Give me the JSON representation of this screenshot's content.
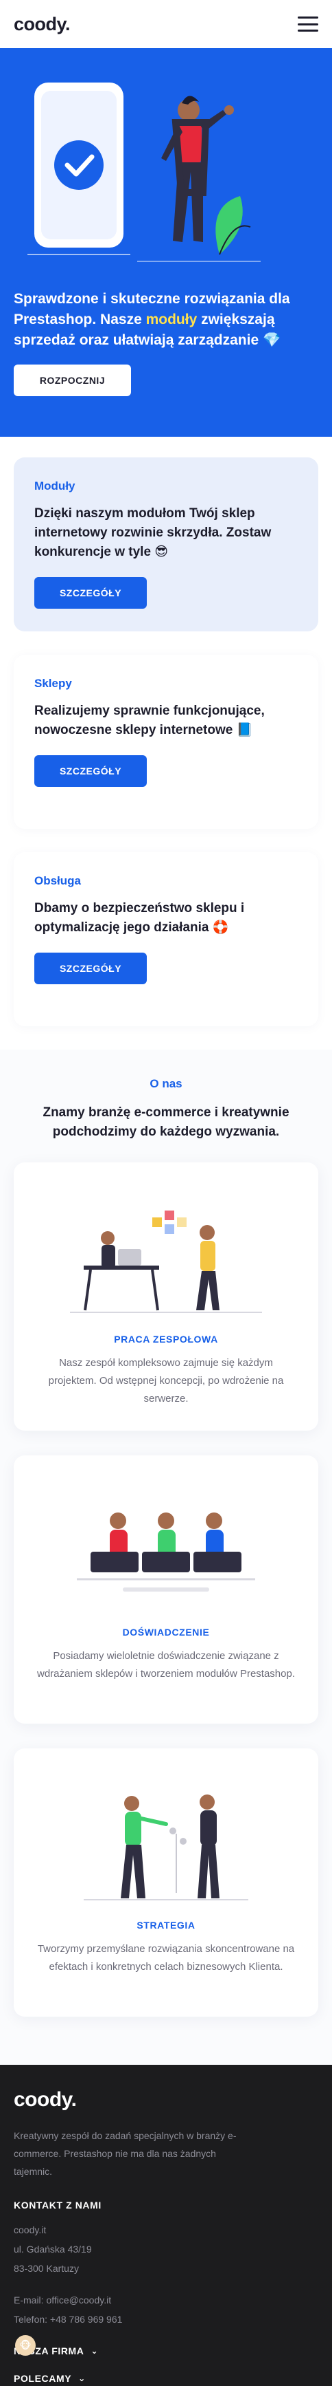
{
  "header": {
    "logo": "coody.",
    "menu_icon": "hamburger-menu-icon"
  },
  "hero": {
    "text_a": "Sprawdzone i skuteczne rozwiązania dla Prestashop. Nasze ",
    "text_highlight": "moduły",
    "text_b": " zwiększają sprzedaż oraz ułatwiają zarządzanie",
    "emoji": "💎",
    "button": "ROZPOCZNIJ",
    "colors": {
      "background": "#1860e8",
      "highlight": "#ffe14d"
    }
  },
  "services": [
    {
      "title": "Moduły",
      "text": "Dzięki naszym modułom Twój sklep internetowy rozwinie skrzydła. Zostaw konkurencje w tyle 😎",
      "button": "SZCZEGÓŁY"
    },
    {
      "title": "Sklepy",
      "text": "Realizujemy sprawnie funkcjonujące, nowoczesne sklepy internetowe 📘",
      "button": "SZCZEGÓŁY"
    },
    {
      "title": "Obsługa",
      "text": "Dbamy o bezpieczeństwo sklepu i optymalizację jego działania 🛟",
      "button": "SZCZEGÓŁY"
    }
  ],
  "about": {
    "title": "O nas",
    "heading": "Znamy branżę e-commerce i kreatywnie podchodzimy do każdego wyzwania.",
    "features": [
      {
        "title": "PRACA ZESPOŁOWA",
        "text": "Nasz zespół kompleksowo zajmuje się każdym projektem. Od wstępnej koncepcji, po wdrożenie na serwerze."
      },
      {
        "title": "DOŚWIADCZENIE",
        "text": "Posiadamy wieloletnie doświadczenie związane z wdrażaniem sklepów i tworzeniem modułów Prestashop."
      },
      {
        "title": "STRATEGIA",
        "text": "Tworzymy przemyślane rozwiązania skoncentrowane na efektach i konkretnych celach biznesowych Klienta."
      }
    ]
  },
  "footer": {
    "logo": "coody.",
    "description": "Kreatywny zespół do zadań specjalnych w branży e-commerce. Prestashop nie ma dla nas żadnych tajemnic.",
    "contact_heading": "KONTAKT Z NAMI",
    "address": [
      "coody.it",
      "ul. Gdańska 43/19",
      "83-300 Kartuzy"
    ],
    "email": "E-mail: office@coody.it",
    "phone": "Telefon: +48 786 969 961",
    "menu1": "NASZA FIRMA",
    "menu2": "POLECAMY"
  }
}
